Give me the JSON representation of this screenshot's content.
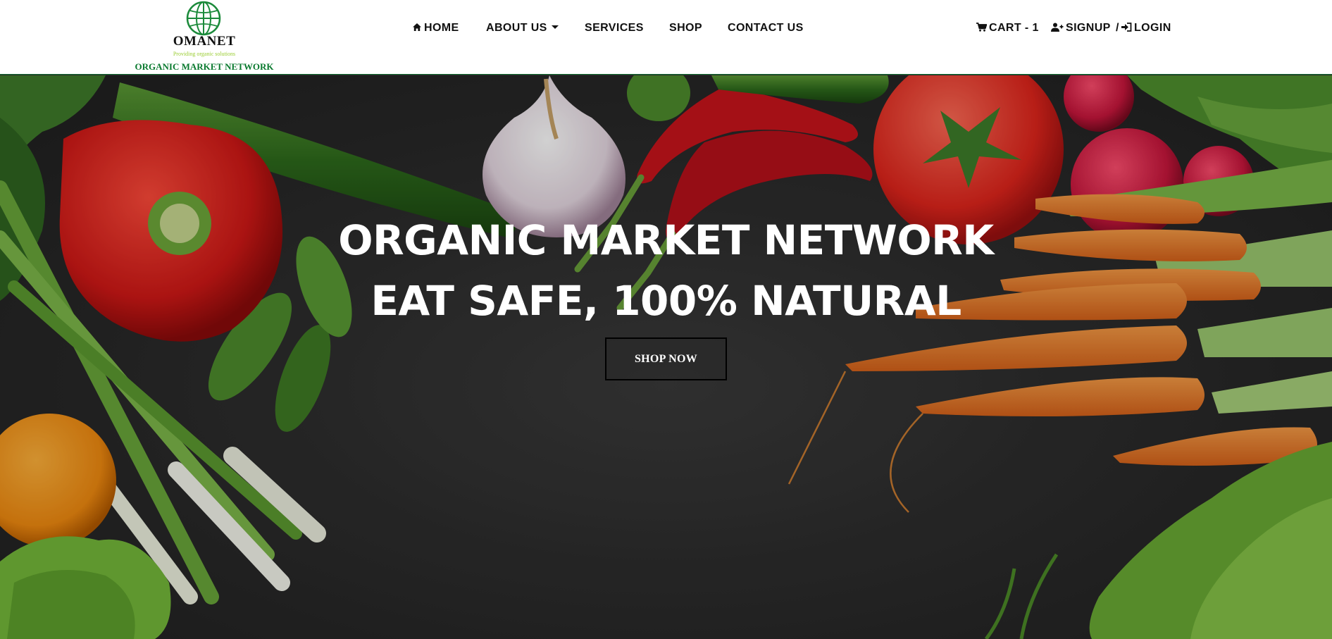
{
  "brand": {
    "name": "OMANET",
    "tagline": "Providing organic solutions",
    "full_name": "ORGANIC MARKET NETWORK",
    "logo_icon": "globe-icon",
    "color": "#0a7a2f"
  },
  "nav": {
    "home": "HOME",
    "about": "ABOUT US",
    "services": "SERVICES",
    "shop": "SHOP",
    "contact": "CONTACT US",
    "cart": "CART - 1",
    "signup": "SIGNUP",
    "separator": "/",
    "login": "LOGIN",
    "icons": [
      "home-icon",
      "chevron-down-icon",
      "cart-icon",
      "user-plus-icon",
      "sign-in-icon"
    ]
  },
  "hero": {
    "title_line1": "ORGANIC MARKET NETWORK",
    "title_line2": "EAT SAFE, 100% NATURAL",
    "cta": "SHOP NOW",
    "text_color": "#ffffff",
    "background": "vegetables on dark slate"
  }
}
